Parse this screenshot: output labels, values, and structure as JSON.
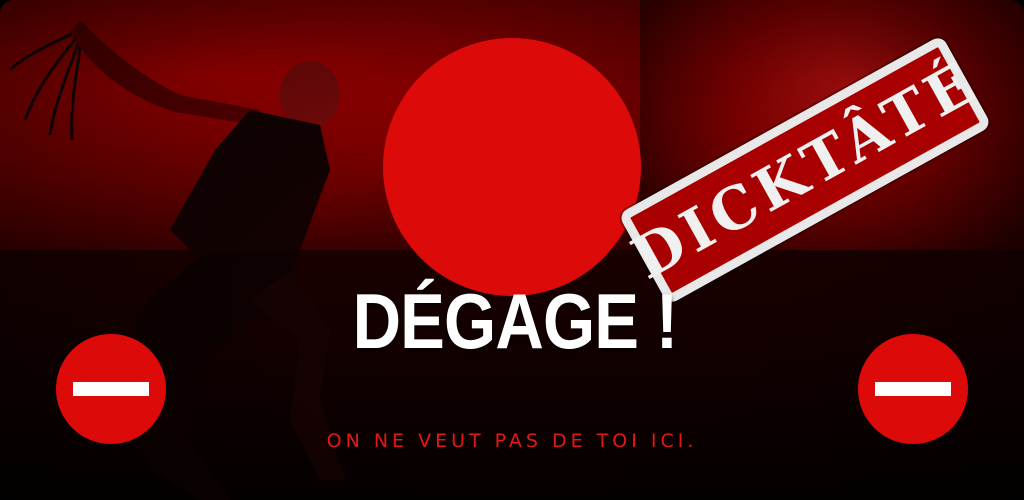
{
  "banner": {
    "title": "DÉGAGE !",
    "subtitle": "ON NE VEUT PAS DE TOI ICI.",
    "stamp_text": "DICKTÂTÉ"
  },
  "icons": {
    "left_sign": "no-entry-icon",
    "right_sign": "no-entry-icon"
  },
  "colors": {
    "accent_red": "#dd0a0a",
    "subtitle_red": "#e01818",
    "title_white": "#ffffff"
  }
}
